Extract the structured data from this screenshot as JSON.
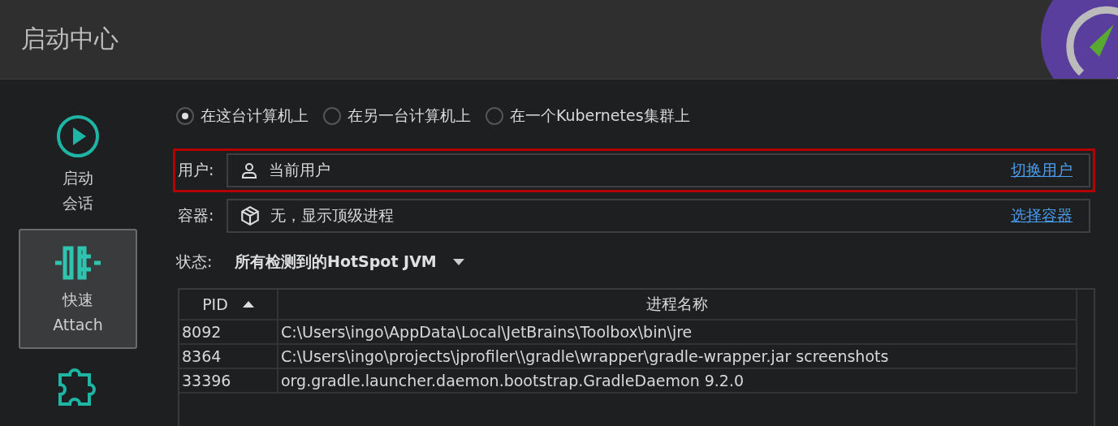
{
  "header": {
    "title": "启动中心"
  },
  "sidebar": {
    "items": [
      {
        "kind": "play",
        "label_lines": [
          "启动",
          "会话"
        ],
        "selected": false
      },
      {
        "kind": "attach",
        "label_lines": [
          "快速",
          "Attach"
        ],
        "selected": true
      },
      {
        "kind": "plugin",
        "selected": false
      }
    ]
  },
  "target": {
    "options": [
      {
        "label": "在这台计算机上",
        "selected": true
      },
      {
        "label": "在另一台计算机上",
        "selected": false
      },
      {
        "label": "在一个Kubernetes集群上",
        "selected": false
      }
    ]
  },
  "fields": [
    {
      "kind": "user",
      "label": "用户:",
      "value": "当前用户",
      "link": "切换用户",
      "highlighted": true
    },
    {
      "kind": "container",
      "label": "容器:",
      "value": "无，显示顶级进程",
      "link": "选择容器",
      "highlighted": false
    }
  ],
  "status": {
    "label": "状态:",
    "value": "所有检测到的HotSpot JVM"
  },
  "table": {
    "columns": [
      {
        "label": "PID",
        "sorted": true
      },
      {
        "label": "进程名称",
        "sorted": false
      }
    ],
    "rows": [
      [
        "8092",
        "C:\\Users\\ingo\\AppData\\Local\\JetBrains\\Toolbox\\bin\\jre"
      ],
      [
        "8364",
        "C:\\Users\\ingo\\projects\\jprofiler\\\\gradle\\wrapper\\gradle-wrapper.jar screenshots"
      ],
      [
        "33396",
        "org.gradle.launcher.daemon.bootstrap.GradleDaemon 9.2.0"
      ]
    ]
  }
}
